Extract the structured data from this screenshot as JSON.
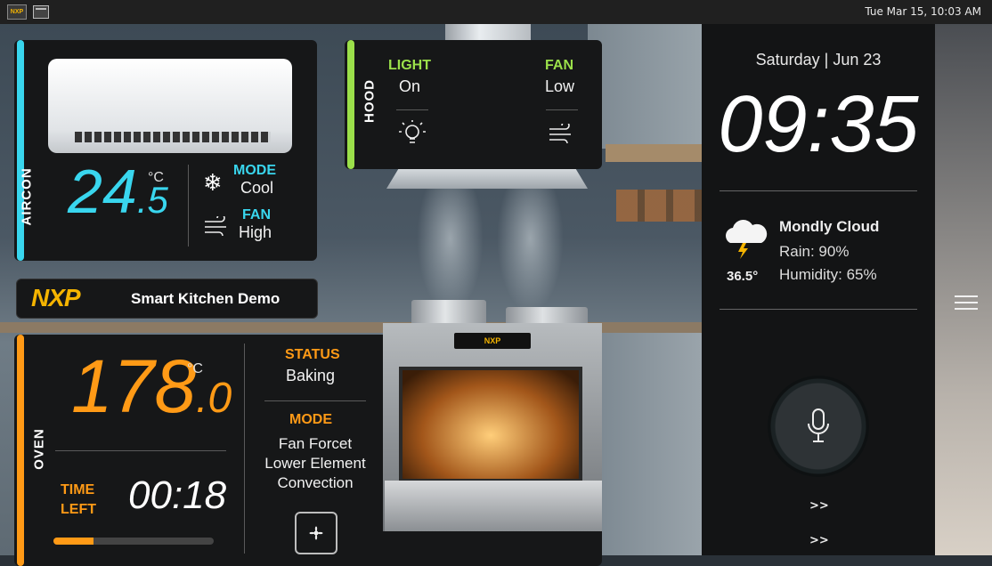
{
  "topbar": {
    "logo_text": "NXP",
    "clock": "Tue Mar 15, 10:03 AM"
  },
  "aircon": {
    "label": "AIRCON",
    "temp_int": "24",
    "temp_dec": ".5",
    "unit": "°C",
    "mode_label": "MODE",
    "mode_value": "Cool",
    "fan_label": "FAN",
    "fan_value": "High",
    "accent": "#39d6ee"
  },
  "hood": {
    "label": "HOOD",
    "light_label": "LIGHT",
    "light_value": "On",
    "fan_label": "FAN",
    "fan_value": "Low",
    "accent": "#9be04a"
  },
  "brand": {
    "logo": "NXP",
    "title": "Smart Kitchen Demo"
  },
  "oven": {
    "label": "OVEN",
    "temp_int": "178",
    "temp_dec": ".0",
    "unit": "°C",
    "time_label_1": "TIME",
    "time_label_2": "LEFT",
    "time_left": "00:18",
    "status_label": "STATUS",
    "status_value": "Baking",
    "mode_label": "MODE",
    "mode_lines": [
      "Fan Forcet",
      "Lower Element",
      "Convection"
    ],
    "progress": 0.25,
    "display_logo": "NXP",
    "accent": "#ff9a16"
  },
  "sidebar": {
    "date_day": "Saturday",
    "date_sep": "|",
    "date": "Jun 23",
    "time": "09:35",
    "weather_title": "Mondly Cloud",
    "weather_temp": "36.5°",
    "rain": "Rain: 90%",
    "humidity": "Humidity: 65%",
    "arrow_1": ">>",
    "arrow_2": ">>"
  }
}
